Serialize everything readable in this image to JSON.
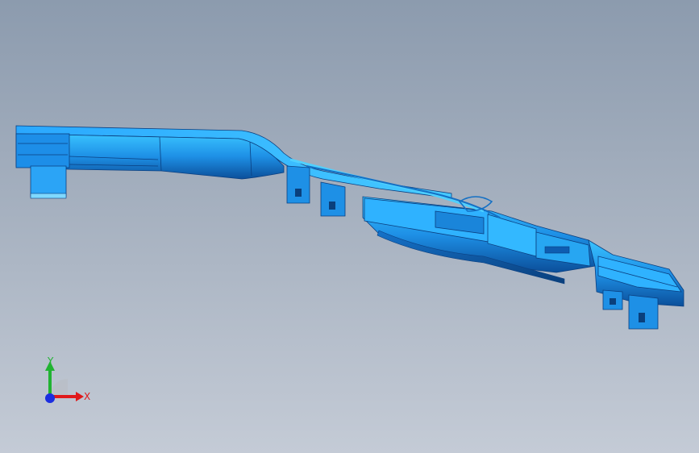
{
  "viewport": {
    "colors": {
      "model_base": "#1e90e6",
      "model_light": "#39c3ff",
      "model_dark": "#0b4f9a",
      "background_top": "#8c9bae",
      "background_bottom": "#c4cbd6"
    }
  },
  "triad": {
    "x_label": "X",
    "y_label": "Y",
    "x_color": "#e0191b",
    "y_color": "#21b332",
    "z_color": "#1b2ee0",
    "icon": "coordinate-triad-icon"
  }
}
